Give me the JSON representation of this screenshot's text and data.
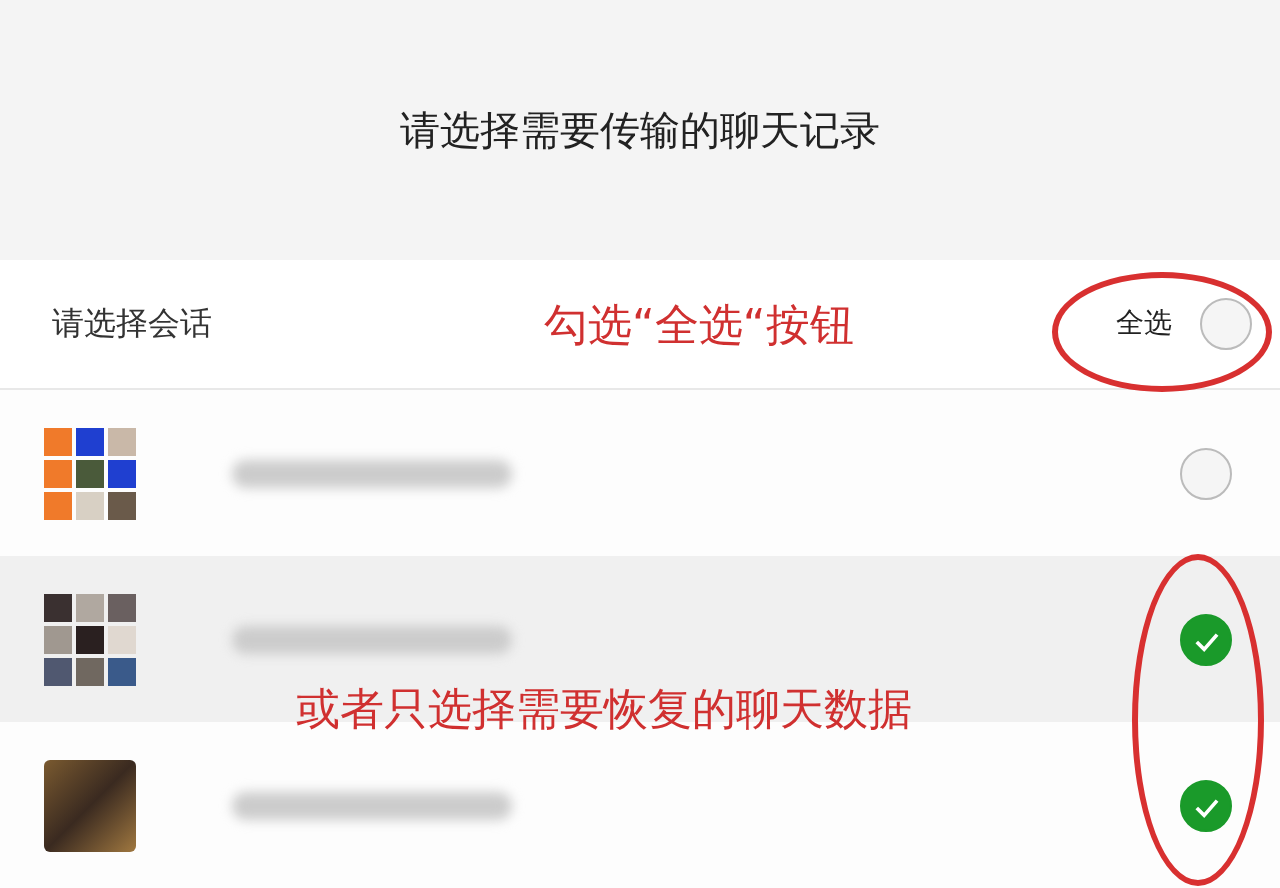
{
  "header": {
    "title": "请选择需要传输的聊天记录"
  },
  "subheader": {
    "label": "请选择会话",
    "select_all": {
      "label": "全选",
      "checked": false
    }
  },
  "chats": [
    {
      "checked": false,
      "highlighted": false,
      "kind": "group"
    },
    {
      "checked": true,
      "highlighted": true,
      "kind": "group"
    },
    {
      "checked": true,
      "highlighted": false,
      "kind": "single"
    }
  ],
  "annotations": [
    {
      "text": "勾选“全选“按钮"
    },
    {
      "text": "或者只选择需要恢复的聊天数据"
    }
  ]
}
